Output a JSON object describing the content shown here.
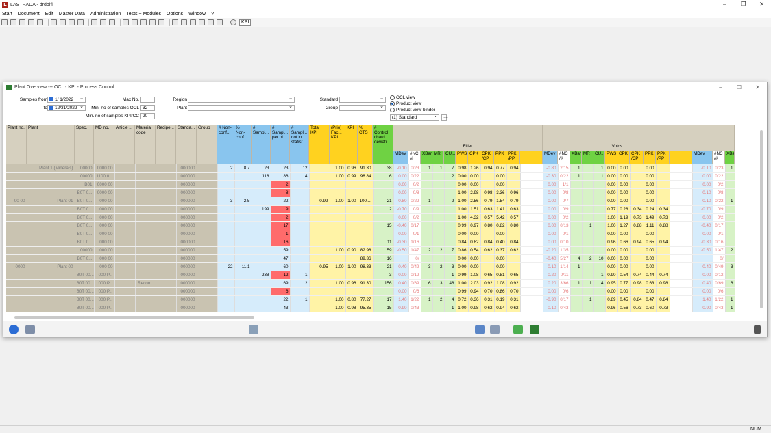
{
  "app": {
    "title": "LASTRADA - drdolfi"
  },
  "menu": [
    "Start",
    "Document",
    "Edit",
    "Master Data",
    "Administration",
    "Tests + Modules",
    "Options",
    "Window",
    "?"
  ],
  "toolbar": {
    "kpi_label": "KPI"
  },
  "child": {
    "title": "Plant Overview --- OCL - KPI - Process Control"
  },
  "filters": {
    "samples_from_label": "Samples from",
    "samples_from": "1/ 1/2022",
    "to_label": "to",
    "to": "12/31/2022",
    "maxno_label": "Max No.",
    "maxno": "",
    "min_ocl_label": "Min. no of samples OCL",
    "min_ocl": "32",
    "min_kpi_label": "Min. no of samples KPI/CC",
    "min_kpi": "20",
    "region_label": "Region",
    "plant_label": "Plant",
    "standard_label": "Standard",
    "group_label": "Group",
    "view_ocl": "OCL view",
    "view_product": "Product view",
    "view_binder": "Product view binder",
    "standard_sel": "(1) Standard"
  },
  "headers": {
    "left": [
      "Plant no.",
      "Plant",
      "Spec.",
      "MD no.",
      "Article ...",
      "Material code",
      "Recipe...",
      "Standa...",
      "Group"
    ],
    "blue": [
      "# Non-conf...",
      "% Non-conf...",
      "# Sampl...",
      "# Sampl... per pl...",
      "# Sampl... not in statist..."
    ],
    "yellow": [
      "Total KPI",
      "(Prio) Fac... KPI",
      "KPI",
      "% CTS"
    ],
    "green": [
      "# Control chard deviati..."
    ],
    "filler": "Filler",
    "voids": "Voids",
    "sub": [
      "MDev",
      "#NC /#",
      "XBar",
      "MR",
      "CU...",
      "PWS",
      "CPK",
      "CPK /CP",
      "PPK",
      "PPK /PP",
      ""
    ]
  },
  "rows": [
    {
      "l": [
        "",
        "Plant 1 (Minerals)",
        "00000",
        "0000 00",
        "",
        "",
        "",
        "000000",
        ""
      ],
      "b": [
        "2",
        "8.7",
        "23",
        "23",
        "12"
      ],
      "y": [
        "",
        "1.00",
        "0.96",
        "91.30"
      ],
      "g": "38",
      "f": [
        "-0.10",
        "0/23",
        "1",
        "1",
        "7",
        "0.98",
        "1.26",
        "0.94",
        "0.77",
        "0.94"
      ],
      "v": [
        "-0.80",
        "2/15",
        "1",
        "",
        "1",
        "0.00",
        "0.00",
        "",
        "0.00",
        ""
      ],
      "e": [
        "-0.10",
        "0/23",
        "1"
      ]
    },
    {
      "l": [
        "",
        "",
        "00000",
        "1100 0...",
        "",
        "",
        "",
        "000000",
        ""
      ],
      "b": [
        "",
        "",
        "118",
        "86",
        "4"
      ],
      "y": [
        "",
        "1.00",
        "0.99",
        "98.84"
      ],
      "g": "6",
      "f": [
        "0.00",
        "0/22",
        "",
        "",
        "2",
        "0.00",
        "0.00",
        "",
        "0.00",
        ""
      ],
      "v": [
        "-0.30",
        "0/22",
        "1",
        "",
        "1",
        "0.00",
        "0.00",
        "",
        "0.00",
        ""
      ],
      "e": [
        "0.00",
        "0/22",
        ""
      ]
    },
    {
      "l": [
        "",
        "",
        "B01",
        "0000 00",
        "",
        "",
        "",
        "000000",
        ""
      ],
      "b": [
        "",
        "",
        "",
        "2",
        ""
      ],
      "y": [
        "",
        "",
        "",
        ""
      ],
      "g": "",
      "f": [
        "0.00",
        "0/2",
        "",
        "",
        "",
        "0.00",
        "0.00",
        "",
        "0.00",
        ""
      ],
      "v": [
        "0.00",
        "1/1",
        "",
        "",
        "",
        "0.00",
        "0.00",
        "",
        "0.00",
        ""
      ],
      "e": [
        "0.00",
        "0/2",
        ""
      ]
    },
    {
      "l": [
        "",
        "",
        "B0T 0...",
        "0000 00",
        "",
        "",
        "",
        "000000",
        ""
      ],
      "b": [
        "",
        "",
        "",
        "8",
        ""
      ],
      "y": [
        "",
        "",
        "",
        ""
      ],
      "g": "",
      "f": [
        "0.00",
        "0/8",
        "",
        "",
        "",
        "1.00",
        "2.98",
        "0.98",
        "3.36",
        "0.96"
      ],
      "v": [
        "0.00",
        "0/8",
        "",
        "",
        "",
        "0.00",
        "0.00",
        "",
        "0.00",
        ""
      ],
      "e": [
        "0.10",
        "0/8",
        ""
      ]
    },
    {
      "l": [
        "00 00",
        "Plant 01",
        "B0T 0...",
        "000 00",
        "",
        "",
        "",
        "000000",
        ""
      ],
      "b": [
        "3",
        "2.5",
        "",
        "22",
        ""
      ],
      "y": [
        "0.99",
        "1.00",
        "1.00",
        "100...."
      ],
      "g": "21",
      "f": [
        "0.80",
        "0/22",
        "1",
        "",
        "9",
        "1.00",
        "2.56",
        "0.79",
        "1.54",
        "0.79"
      ],
      "v": [
        "0.00",
        "0/7",
        "",
        "",
        "",
        "0.00",
        "0.00",
        "",
        "0.00",
        ""
      ],
      "e": [
        "-0.10",
        "0/22",
        "1"
      ]
    },
    {
      "l": [
        "",
        "",
        "B0T 0...",
        "000 00",
        "",
        "",
        "",
        "000000",
        ""
      ],
      "b": [
        "",
        "",
        "199",
        "9",
        ""
      ],
      "y": [
        "",
        "",
        "",
        ""
      ],
      "g": "2",
      "f": [
        "-0.70",
        "0/9",
        "",
        "",
        "",
        "1.00",
        "1.51",
        "0.63",
        "1.41",
        "0.63"
      ],
      "v": [
        "0.00",
        "0/9",
        "",
        "",
        "",
        "0.77",
        "0.28",
        "0.34",
        "0.24",
        "0.34"
      ],
      "e": [
        "-0.70",
        "0/9",
        ""
      ]
    },
    {
      "l": [
        "",
        "",
        "B0T 0...",
        "000 00",
        "",
        "",
        "",
        "000000",
        ""
      ],
      "b": [
        "",
        "",
        "",
        "2",
        ""
      ],
      "y": [
        "",
        "",
        "",
        ""
      ],
      "g": "",
      "f": [
        "0.00",
        "0/2",
        "",
        "",
        "",
        "1.00",
        "4.32",
        "0.57",
        "5.42",
        "0.57"
      ],
      "v": [
        "0.00",
        "0/2",
        "",
        "",
        "",
        "1.00",
        "1.19",
        "0.73",
        "1.49",
        "0.73"
      ],
      "e": [
        "0.00",
        "0/2",
        ""
      ]
    },
    {
      "l": [
        "",
        "",
        "B0T 0...",
        "000 00",
        "",
        "",
        "",
        "000000",
        ""
      ],
      "b": [
        "",
        "",
        "",
        "17",
        ""
      ],
      "y": [
        "",
        "",
        "",
        ""
      ],
      "g": "15",
      "f": [
        "-0.40",
        "0/17",
        "",
        "",
        "",
        "0.99",
        "0.97",
        "0.80",
        "0.82",
        "0.80"
      ],
      "v": [
        "0.00",
        "0/13",
        "",
        "1",
        "",
        "1.00",
        "1.27",
        "0.88",
        "1.11",
        "0.88"
      ],
      "e": [
        "-0.40",
        "0/17",
        ""
      ]
    },
    {
      "l": [
        "",
        "",
        "B0T 0...",
        "000 00",
        "",
        "",
        "",
        "000000",
        ""
      ],
      "b": [
        "",
        "",
        "",
        "1",
        ""
      ],
      "y": [
        "",
        "",
        "",
        ""
      ],
      "g": "",
      "f": [
        "0.00",
        "0/1",
        "",
        "",
        "",
        "0.00",
        "0.00",
        "",
        "0.00",
        ""
      ],
      "v": [
        "0.00",
        "0/1",
        "",
        "",
        "",
        "0.00",
        "0.00",
        "",
        "0.00",
        ""
      ],
      "e": [
        "0.00",
        "0/1",
        ""
      ]
    },
    {
      "l": [
        "",
        "",
        "B0T 0...",
        "000 00",
        "",
        "",
        "",
        "000000",
        ""
      ],
      "b": [
        "",
        "",
        "",
        "16",
        ""
      ],
      "y": [
        "",
        "",
        "",
        ""
      ],
      "g": "11",
      "f": [
        "-0.30",
        "1/16",
        "",
        "",
        "",
        "0.84",
        "0.82",
        "0.84",
        "0.40",
        "0.84"
      ],
      "v": [
        "0.00",
        "0/10",
        "",
        "",
        "",
        "0.96",
        "0.66",
        "0.94",
        "0.65",
        "0.94"
      ],
      "e": [
        "-0.30",
        "0/16",
        ""
      ]
    },
    {
      "l": [
        "",
        "",
        "00000",
        "000 00",
        "",
        "",
        "",
        "000000",
        ""
      ],
      "b": [
        "",
        "",
        "",
        "59",
        ""
      ],
      "y": [
        "",
        "1.00",
        "0.90",
        "82.98"
      ],
      "g": "59",
      "f": [
        "-0.50",
        "1/47",
        "2",
        "2",
        "7",
        "0.86",
        "0.54",
        "0.62",
        "0.37",
        "0.62"
      ],
      "v": [
        "-0.20",
        "1/35",
        "",
        "",
        "",
        "0.00",
        "0.00",
        "",
        "0.00",
        ""
      ],
      "e": [
        "-0.50",
        "1/47",
        "2"
      ]
    },
    {
      "l": [
        "",
        "",
        "B0T 0...",
        "000 00",
        "",
        "",
        "",
        "000000",
        ""
      ],
      "b": [
        "",
        "",
        "",
        "47",
        ""
      ],
      "y": [
        "",
        "",
        "",
        "89.36"
      ],
      "g": "16",
      "f": [
        "",
        "0/",
        "",
        "",
        "",
        "0.00",
        "0.00",
        "",
        "0.00",
        ""
      ],
      "v": [
        "-0.40",
        "5/27",
        "4",
        "2",
        "10",
        "0.00",
        "0.00",
        "",
        "0.00",
        ""
      ],
      "e": [
        "",
        "0/",
        ""
      ]
    },
    {
      "l": [
        "0000",
        "Plant 00",
        "",
        "000 00",
        "",
        "",
        "",
        "000000",
        ""
      ],
      "b": [
        "22",
        "11.1",
        "",
        "60",
        ""
      ],
      "y": [
        "0.95",
        "1.00",
        "1.00",
        "98.33"
      ],
      "g": "21",
      "f": [
        "-0.40",
        "0/49",
        "3",
        "2",
        "3",
        "0.00",
        "0.00",
        "",
        "0.00",
        ""
      ],
      "v": [
        "0.10",
        "1/14",
        "1",
        "",
        "",
        "0.00",
        "0.00",
        "",
        "0.00",
        ""
      ],
      "e": [
        "-0.40",
        "0/49",
        "3"
      ]
    },
    {
      "l": [
        "",
        "",
        "B0T 00...",
        "000 P...",
        "",
        "",
        "",
        "000000",
        ""
      ],
      "b": [
        "",
        "",
        "238",
        "12",
        "1"
      ],
      "y": [
        "",
        "",
        "",
        ""
      ],
      "g": "3",
      "f": [
        "0.00",
        "0/12",
        "",
        "",
        "1",
        "0.99",
        "1.08",
        "0.65",
        "0.81",
        "0.65"
      ],
      "v": [
        "-0.20",
        "0/11",
        "",
        "",
        "1",
        "0.90",
        "0.54",
        "0.74",
        "0.44",
        "0.74"
      ],
      "e": [
        "0.00",
        "0/12",
        ""
      ]
    },
    {
      "l": [
        "",
        "",
        "B0T 00...",
        "000 P...",
        "",
        "Recoo...",
        "",
        "000000",
        ""
      ],
      "b": [
        "",
        "",
        "",
        "69",
        "2"
      ],
      "y": [
        "",
        "1.00",
        "0.96",
        "91.30"
      ],
      "g": "156",
      "f": [
        "0.40",
        "0/69",
        "6",
        "3",
        "48",
        "1.00",
        "2.03",
        "0.92",
        "1.08",
        "0.92"
      ],
      "v": [
        "0.20",
        "3/66",
        "1",
        "1",
        "4",
        "0.95",
        "0.77",
        "0.98",
        "0.63",
        "0.98"
      ],
      "e": [
        "0.40",
        "0/69",
        "6"
      ]
    },
    {
      "l": [
        "",
        "",
        "B0T 00...",
        "000 P...",
        "",
        "",
        "",
        "000000",
        ""
      ],
      "b": [
        "",
        "",
        "",
        "6",
        ""
      ],
      "y": [
        "",
        "",
        "",
        ""
      ],
      "g": "",
      "f": [
        "0.00",
        "0/6",
        "",
        "",
        "",
        "0.99",
        "0.94",
        "0.70",
        "0.86",
        "0.70"
      ],
      "v": [
        "0.00",
        "0/6",
        "",
        "",
        "",
        "0.00",
        "0.00",
        "",
        "0.00",
        ""
      ],
      "e": [
        "0.00",
        "0/6",
        ""
      ]
    },
    {
      "l": [
        "",
        "",
        "B0T 00...",
        "000 P...",
        "",
        "",
        "",
        "000000",
        ""
      ],
      "b": [
        "",
        "",
        "",
        "22",
        "1"
      ],
      "y": [
        "",
        "1.00",
        "0.80",
        "77.27"
      ],
      "g": "17",
      "f": [
        "1.40",
        "1/22",
        "1",
        "2",
        "4",
        "0.72",
        "0.36",
        "0.31",
        "0.19",
        "0.31"
      ],
      "v": [
        "-0.90",
        "0/17",
        "",
        "1",
        "",
        "0.89",
        "0.45",
        "0.84",
        "0.47",
        "0.84"
      ],
      "e": [
        "1.40",
        "1/22",
        "1"
      ]
    },
    {
      "l": [
        "",
        "",
        "B0T 00...",
        "000 P...",
        "",
        "",
        "",
        "000000",
        ""
      ],
      "b": [
        "",
        "",
        "",
        "43",
        ""
      ],
      "y": [
        "",
        "1.00",
        "0.98",
        "95.35"
      ],
      "g": "15",
      "f": [
        "0.90",
        "0/43",
        "",
        "",
        "1",
        "1.00",
        "0.98",
        "0.62",
        "0.94",
        "0.62"
      ],
      "v": [
        "-0.10",
        "0/43",
        "",
        "",
        "",
        "0.96",
        "0.56",
        "0.73",
        "0.60",
        "0.73"
      ],
      "e": [
        "0.90",
        "0/43",
        "1"
      ]
    }
  ],
  "status": {
    "num": "NUM"
  },
  "icons": {
    "refresh": "refresh-icon",
    "print": "print-icon",
    "binoculars": "binoculars-icon"
  }
}
